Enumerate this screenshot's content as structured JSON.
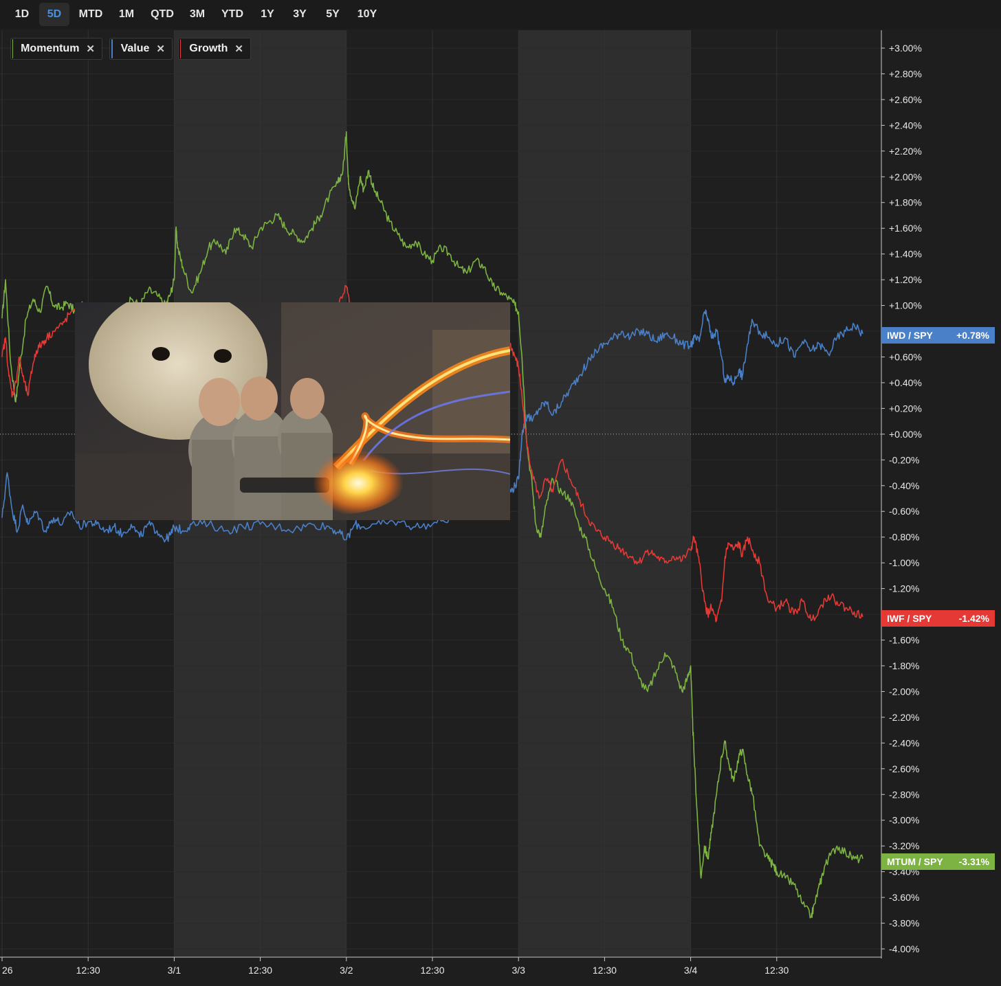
{
  "toolbar": {
    "ranges": [
      "1D",
      "5D",
      "MTD",
      "1M",
      "QTD",
      "3M",
      "YTD",
      "1Y",
      "3Y",
      "5Y",
      "10Y"
    ],
    "active": "5D"
  },
  "legend": [
    {
      "label": "Momentum",
      "color": "#7cb342"
    },
    {
      "label": "Value",
      "color": "#4a80c8"
    },
    {
      "label": "Growth",
      "color": "#e53935"
    }
  ],
  "tags": [
    {
      "name": "IWD / SPY",
      "value": "+0.78%",
      "color": "#4a80c8"
    },
    {
      "name": "IWF / SPY",
      "value": "-1.42%",
      "color": "#e53935"
    },
    {
      "name": "MTUM / SPY",
      "value": "-3.31%",
      "color": "#7cb342"
    }
  ],
  "chart_data": {
    "type": "line",
    "x_tick_labels": [
      "26",
      "12:30",
      "3/1",
      "12:30",
      "3/2",
      "12:30",
      "3/3",
      "12:30",
      "3/4",
      "12:30"
    ],
    "y_tick_labels": [
      "+3.00%",
      "+2.80%",
      "+2.60%",
      "+2.40%",
      "+2.20%",
      "+2.00%",
      "+1.80%",
      "+1.60%",
      "+1.40%",
      "+1.20%",
      "+1.00%",
      "+0.80%",
      "+0.60%",
      "+0.40%",
      "+0.20%",
      "+0.00%",
      "-0.20%",
      "-0.40%",
      "-0.60%",
      "-0.80%",
      "-1.00%",
      "-1.20%",
      "-1.40%",
      "-1.60%",
      "-1.80%",
      "-2.00%",
      "-2.20%",
      "-2.40%",
      "-2.60%",
      "-2.80%",
      "-3.00%",
      "-3.20%",
      "-3.40%",
      "-3.60%",
      "-3.80%",
      "-4.00%"
    ],
    "ylim": [
      -4.0,
      3.0
    ],
    "xlim": [
      0,
      5
    ],
    "shaded_days": [
      1,
      3
    ],
    "series": [
      {
        "name": "MTUM / SPY",
        "color": "#7cb342",
        "x": [
          0,
          0.02,
          0.05,
          0.08,
          0.1,
          0.14,
          0.18,
          0.22,
          0.26,
          0.3,
          0.34,
          0.38,
          0.42,
          0.46,
          0.5,
          0.55,
          0.6,
          0.65,
          0.7,
          0.75,
          0.8,
          0.85,
          0.9,
          0.95,
          0.98,
          1.0,
          1.01,
          1.02,
          1.05,
          1.1,
          1.15,
          1.2,
          1.25,
          1.3,
          1.35,
          1.4,
          1.45,
          1.5,
          1.55,
          1.6,
          1.65,
          1.7,
          1.75,
          1.8,
          1.85,
          1.9,
          1.95,
          1.98,
          2.0,
          2.01,
          2.02,
          2.05,
          2.08,
          2.1,
          2.13,
          2.16,
          2.2,
          2.25,
          2.3,
          2.35,
          2.4,
          2.45,
          2.5,
          2.55,
          2.6,
          2.65,
          2.7,
          2.75,
          2.8,
          2.85,
          2.9,
          2.95,
          2.98,
          3.0,
          3.02,
          3.05,
          3.08,
          3.1,
          3.13,
          3.16,
          3.2,
          3.25,
          3.3,
          3.35,
          3.4,
          3.45,
          3.5,
          3.55,
          3.6,
          3.65,
          3.7,
          3.75,
          3.8,
          3.85,
          3.9,
          3.95,
          3.98,
          4.0,
          4.01,
          4.02,
          4.04,
          4.06,
          4.08,
          4.1,
          4.12,
          4.15,
          4.18,
          4.2,
          4.22,
          4.25,
          4.28,
          4.3,
          4.33,
          4.36,
          4.4,
          4.45,
          4.48,
          4.5,
          4.55,
          4.6,
          4.65,
          4.7,
          4.72,
          4.75,
          4.78,
          4.8,
          4.85,
          4.9,
          4.95,
          5.0
        ],
        "y": [
          0.9,
          1.2,
          0.55,
          0.25,
          0.5,
          0.9,
          1.05,
          0.95,
          1.15,
          1.0,
          0.98,
          1.02,
          0.96,
          1.0,
          0.95,
          0.9,
          0.92,
          0.85,
          0.9,
          1.05,
          1.0,
          1.12,
          1.08,
          1.0,
          1.1,
          1.2,
          1.6,
          1.45,
          1.3,
          1.1,
          1.25,
          1.45,
          1.5,
          1.4,
          1.6,
          1.55,
          1.45,
          1.6,
          1.65,
          1.7,
          1.6,
          1.55,
          1.5,
          1.6,
          1.7,
          1.85,
          1.95,
          2.05,
          2.35,
          2.0,
          1.9,
          1.75,
          2.0,
          1.9,
          2.05,
          1.9,
          1.8,
          1.65,
          1.55,
          1.45,
          1.5,
          1.4,
          1.35,
          1.45,
          1.4,
          1.3,
          1.25,
          1.35,
          1.3,
          1.15,
          1.1,
          1.05,
          1.0,
          0.95,
          0.6,
          -0.1,
          -0.4,
          -0.7,
          -0.8,
          -0.55,
          -0.35,
          -0.45,
          -0.5,
          -0.7,
          -0.85,
          -1.05,
          -1.2,
          -1.35,
          -1.6,
          -1.7,
          -1.9,
          -2.0,
          -1.85,
          -1.7,
          -1.8,
          -2.0,
          -1.9,
          -1.8,
          -2.2,
          -2.5,
          -3.0,
          -3.45,
          -3.2,
          -3.3,
          -3.1,
          -2.8,
          -2.5,
          -2.4,
          -2.55,
          -2.7,
          -2.5,
          -2.45,
          -2.65,
          -2.8,
          -3.2,
          -3.3,
          -3.35,
          -3.4,
          -3.45,
          -3.5,
          -3.65,
          -3.75,
          -3.65,
          -3.5,
          -3.35,
          -3.3,
          -3.2,
          -3.25,
          -3.3,
          -3.3
        ]
      },
      {
        "name": "IWD / SPY",
        "color": "#4a80c8",
        "x": [
          0,
          0.03,
          0.06,
          0.09,
          0.12,
          0.15,
          0.2,
          0.25,
          0.3,
          0.35,
          0.4,
          0.45,
          0.5,
          0.55,
          0.6,
          0.65,
          0.7,
          0.75,
          0.8,
          0.85,
          0.9,
          0.95,
          0.98,
          1.0,
          1.05,
          1.1,
          1.2,
          1.3,
          1.4,
          1.5,
          1.6,
          1.7,
          1.8,
          1.9,
          1.95,
          2.0,
          2.05,
          2.1,
          2.2,
          2.3,
          2.4,
          2.5,
          2.6,
          2.7,
          2.8,
          2.9,
          2.95,
          2.98,
          3.0,
          3.02,
          3.05,
          3.08,
          3.12,
          3.16,
          3.2,
          3.25,
          3.3,
          3.35,
          3.4,
          3.45,
          3.5,
          3.55,
          3.6,
          3.65,
          3.7,
          3.75,
          3.8,
          3.85,
          3.9,
          3.95,
          4.0,
          4.02,
          4.05,
          4.08,
          4.1,
          4.12,
          4.15,
          4.18,
          4.2,
          4.22,
          4.25,
          4.28,
          4.3,
          4.33,
          4.36,
          4.4,
          4.45,
          4.5,
          4.55,
          4.6,
          4.65,
          4.7,
          4.75,
          4.8,
          4.85,
          4.9,
          4.95,
          5.0
        ],
        "y": [
          -0.65,
          -0.3,
          -0.6,
          -0.75,
          -0.55,
          -0.7,
          -0.6,
          -0.75,
          -0.65,
          -0.7,
          -0.6,
          -0.72,
          -0.68,
          -0.7,
          -0.75,
          -0.72,
          -0.78,
          -0.7,
          -0.8,
          -0.7,
          -0.75,
          -0.82,
          -0.78,
          -0.72,
          -0.75,
          -0.7,
          -0.7,
          -0.75,
          -0.72,
          -0.7,
          -0.72,
          -0.74,
          -0.7,
          -0.72,
          -0.76,
          -0.82,
          -0.7,
          -0.72,
          -0.7,
          -0.68,
          -0.72,
          -0.7,
          -0.65,
          -0.6,
          -0.55,
          -0.5,
          -0.45,
          -0.4,
          -0.35,
          0.0,
          0.15,
          0.1,
          0.2,
          0.25,
          0.15,
          0.25,
          0.35,
          0.45,
          0.55,
          0.65,
          0.7,
          0.75,
          0.8,
          0.75,
          0.8,
          0.78,
          0.72,
          0.78,
          0.75,
          0.7,
          0.68,
          0.75,
          0.72,
          0.95,
          0.9,
          0.75,
          0.8,
          0.6,
          0.4,
          0.45,
          0.4,
          0.5,
          0.45,
          0.7,
          0.88,
          0.8,
          0.75,
          0.7,
          0.75,
          0.6,
          0.72,
          0.65,
          0.7,
          0.62,
          0.75,
          0.8,
          0.85,
          0.78
        ]
      },
      {
        "name": "IWF / SPY",
        "color": "#e53935",
        "x": [
          0,
          0.02,
          0.04,
          0.06,
          0.08,
          0.1,
          0.12,
          0.15,
          0.18,
          0.2,
          0.23,
          0.26,
          0.3,
          0.35,
          0.4,
          0.5,
          0.6,
          0.7,
          0.8,
          0.9,
          1.0,
          1.1,
          1.2,
          1.3,
          1.4,
          1.5,
          1.6,
          1.7,
          1.8,
          1.9,
          1.95,
          2.0,
          2.02,
          2.05,
          2.1,
          2.2,
          2.3,
          2.4,
          2.5,
          2.6,
          2.7,
          2.8,
          2.9,
          2.95,
          2.98,
          3.0,
          3.02,
          3.05,
          3.08,
          3.12,
          3.16,
          3.2,
          3.25,
          3.3,
          3.35,
          3.4,
          3.45,
          3.5,
          3.55,
          3.6,
          3.65,
          3.7,
          3.75,
          3.8,
          3.85,
          3.9,
          3.95,
          4.0,
          4.02,
          4.05,
          4.08,
          4.1,
          4.12,
          4.15,
          4.18,
          4.2,
          4.22,
          4.25,
          4.28,
          4.3,
          4.33,
          4.36,
          4.4,
          4.45,
          4.5,
          4.55,
          4.6,
          4.65,
          4.7,
          4.75,
          4.8,
          4.85,
          4.9,
          4.95,
          5.0
        ],
        "y": [
          0.6,
          0.75,
          0.45,
          0.3,
          0.4,
          0.6,
          0.45,
          0.3,
          0.55,
          0.65,
          0.7,
          0.75,
          0.8,
          0.85,
          0.95,
          0.9,
          0.95,
          0.92,
          0.95,
          0.9,
          0.95,
          0.92,
          0.95,
          0.93,
          0.96,
          0.92,
          0.95,
          0.97,
          0.95,
          0.96,
          1.0,
          1.15,
          1.0,
          0.95,
          0.92,
          0.95,
          0.9,
          0.92,
          0.95,
          0.9,
          0.92,
          0.88,
          0.85,
          0.7,
          0.6,
          0.52,
          0.3,
          -0.1,
          -0.3,
          -0.5,
          -0.35,
          -0.45,
          -0.2,
          -0.35,
          -0.5,
          -0.65,
          -0.75,
          -0.8,
          -0.85,
          -0.9,
          -0.95,
          -1.0,
          -0.9,
          -0.95,
          -1.0,
          -0.95,
          -0.98,
          -0.9,
          -0.8,
          -1.0,
          -1.3,
          -1.4,
          -1.35,
          -1.45,
          -1.3,
          -0.95,
          -0.85,
          -0.9,
          -0.85,
          -0.95,
          -0.8,
          -0.9,
          -1.0,
          -1.3,
          -1.35,
          -1.3,
          -1.4,
          -1.3,
          -1.45,
          -1.35,
          -1.25,
          -1.3,
          -1.35,
          -1.38,
          -1.42
        ]
      }
    ]
  }
}
